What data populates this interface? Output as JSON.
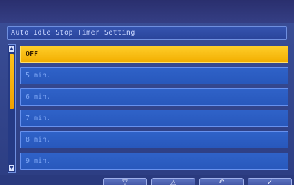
{
  "screen": {
    "title": "Auto Idle Stop Timer Setting"
  },
  "list": {
    "selected_index": 0,
    "items": [
      {
        "label": "OFF"
      },
      {
        "label": "5 min."
      },
      {
        "label": "6 min."
      },
      {
        "label": "7 min."
      },
      {
        "label": "8 min."
      },
      {
        "label": "9 min."
      }
    ]
  },
  "scrollbar": {
    "up_icon": "triangle-up-icon",
    "down_icon": "triangle-down-icon",
    "position_fraction": 0.0
  },
  "softkeys": {
    "down_icon": "triangle-down-icon",
    "up_icon": "triangle-up-icon",
    "back_icon": "return-arrow-icon",
    "confirm_icon": "checkmark-icon"
  },
  "colors": {
    "selected": "#f5b400",
    "item": "#2f62c8",
    "item_text": "#7da6f5",
    "background": "#2c3d82"
  }
}
